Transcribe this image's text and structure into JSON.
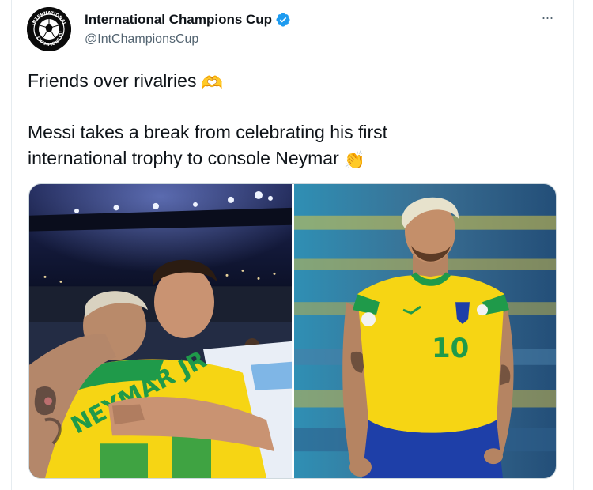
{
  "account": {
    "display_name": "International Champions Cup",
    "handle": "@IntChampionsCup",
    "avatar_text": "INTERNATIONAL CHAMPIONS CUP",
    "verified": true
  },
  "menu": {
    "more_label": "···"
  },
  "tweet": {
    "line1": "Friends over rivalries",
    "line1_emoji": "🫶",
    "line2": "Messi takes a break from celebrating his first",
    "line3": "international trophy to console Neymar",
    "line3_emoji": "👏"
  },
  "media": {
    "left_jersey_name": "NEYMAR JR",
    "right_jersey_number": "10"
  },
  "colors": {
    "verified_blue": "#1d9bf0",
    "text_primary": "#0f1419",
    "text_secondary": "#536471",
    "brazil_yellow": "#f6d514",
    "brazil_green": "#1f9a4a",
    "brazil_blue": "#1e3fa8"
  }
}
